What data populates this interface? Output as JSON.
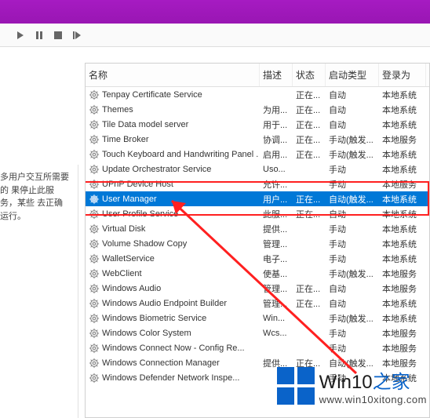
{
  "columns": {
    "name": "名称",
    "desc": "描述",
    "status": "状态",
    "startup": "启动类型",
    "logon": "登录为"
  },
  "left_panel": {
    "line1": "多用户交互所需要的",
    "line2": "果停止此服务，某些",
    "line3": "去正确运行。"
  },
  "services": [
    {
      "name": "Tenpay Certificate Service",
      "desc": "",
      "status": "正在...",
      "startup": "自动",
      "logon": "本地系统"
    },
    {
      "name": "Themes",
      "desc": "为用...",
      "status": "正在...",
      "startup": "自动",
      "logon": "本地系统"
    },
    {
      "name": "Tile Data model server",
      "desc": "用于...",
      "status": "正在...",
      "startup": "自动",
      "logon": "本地系统"
    },
    {
      "name": "Time Broker",
      "desc": "协调...",
      "status": "正在...",
      "startup": "手动(触发...",
      "logon": "本地服务"
    },
    {
      "name": "Touch Keyboard and Handwriting Panel ...",
      "desc": "启用...",
      "status": "正在...",
      "startup": "手动(触发...",
      "logon": "本地系统"
    },
    {
      "name": "Update Orchestrator Service",
      "desc": "Uso...",
      "status": "",
      "startup": "手动",
      "logon": "本地系统"
    },
    {
      "name": "UPnP Device Host",
      "desc": "允许...",
      "status": "",
      "startup": "手动",
      "logon": "本地服务"
    },
    {
      "name": "User Manager",
      "desc": "用户...",
      "status": "正在...",
      "startup": "自动(触发...",
      "logon": "本地系统",
      "selected": true
    },
    {
      "name": "User Profile Service",
      "desc": "此服...",
      "status": "正在...",
      "startup": "自动",
      "logon": "本地系统"
    },
    {
      "name": "Virtual Disk",
      "desc": "提供...",
      "status": "",
      "startup": "手动",
      "logon": "本地系统"
    },
    {
      "name": "Volume Shadow Copy",
      "desc": "管理...",
      "status": "",
      "startup": "手动",
      "logon": "本地系统"
    },
    {
      "name": "WalletService",
      "desc": "电子...",
      "status": "",
      "startup": "手动",
      "logon": "本地系统"
    },
    {
      "name": "WebClient",
      "desc": "使基...",
      "status": "",
      "startup": "手动(触发...",
      "logon": "本地服务"
    },
    {
      "name": "Windows Audio",
      "desc": "管理...",
      "status": "正在...",
      "startup": "自动",
      "logon": "本地服务"
    },
    {
      "name": "Windows Audio Endpoint Builder",
      "desc": "管理...",
      "status": "正在...",
      "startup": "自动",
      "logon": "本地系统"
    },
    {
      "name": "Windows Biometric Service",
      "desc": "Win...",
      "status": "",
      "startup": "手动(触发...",
      "logon": "本地系统"
    },
    {
      "name": "Windows Color System",
      "desc": "Wcs...",
      "status": "",
      "startup": "手动",
      "logon": "本地服务"
    },
    {
      "name": "Windows Connect Now - Config Re...",
      "desc": "",
      "status": "",
      "startup": "手动",
      "logon": "本地服务"
    },
    {
      "name": "Windows Connection Manager",
      "desc": "提供...",
      "status": "正在...",
      "startup": "自动(触发...",
      "logon": "本地服务"
    },
    {
      "name": "Windows Defender Network Inspe...",
      "desc": "",
      "status": "",
      "startup": "手动",
      "logon": "本地系统"
    }
  ],
  "watermark": {
    "brand_main": "Win10",
    "brand_suffix": "之家",
    "url": "www.win10xitong.com"
  }
}
